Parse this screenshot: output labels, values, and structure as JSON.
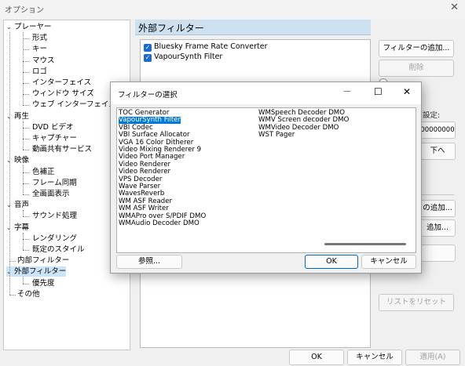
{
  "window": {
    "title": "オプション",
    "close_glyph": "✕"
  },
  "tree": [
    {
      "label": "プレーヤー",
      "level": 0,
      "expanded": true
    },
    {
      "label": "形式",
      "level": 1
    },
    {
      "label": "キー",
      "level": 1
    },
    {
      "label": "マウス",
      "level": 1
    },
    {
      "label": "ロゴ",
      "level": 1
    },
    {
      "label": "インターフェイス",
      "level": 1
    },
    {
      "label": "ウィンドウ サイズ",
      "level": 1
    },
    {
      "label": "ウェブ インターフェイス",
      "level": 1
    },
    {
      "label": "再生",
      "level": 0,
      "expanded": true
    },
    {
      "label": "DVD ビデオ",
      "level": 1
    },
    {
      "label": "キャプチャー",
      "level": 1
    },
    {
      "label": "動画共有サービス",
      "level": 1
    },
    {
      "label": "映像",
      "level": 0,
      "expanded": true
    },
    {
      "label": "色補正",
      "level": 1
    },
    {
      "label": "フレーム同期",
      "level": 1
    },
    {
      "label": "全画面表示",
      "level": 1
    },
    {
      "label": "音声",
      "level": 0,
      "expanded": true
    },
    {
      "label": "サウンド処理",
      "level": 1
    },
    {
      "label": "字幕",
      "level": 0,
      "expanded": true
    },
    {
      "label": "レンダリング",
      "level": 1
    },
    {
      "label": "既定のスタイル",
      "level": 1
    },
    {
      "label": "内部フィルター",
      "level": 0
    },
    {
      "label": "外部フィルター",
      "level": 0,
      "expanded": true,
      "selected": true
    },
    {
      "label": "優先度",
      "level": 1
    },
    {
      "label": "その他",
      "level": 0
    }
  ],
  "panel": {
    "title": "外部フィルター",
    "filters": [
      "Bluesky Frame Rate Converter",
      "VapourSynth Filter"
    ],
    "add_filter": "フィルターの追加...",
    "remove": "削除",
    "partial_setting": "設定:",
    "partial_value": "00000000",
    "partial_down": "下へ",
    "partial_add1": "の追加...",
    "partial_add2": "追加...",
    "reset_list": "リストをリセット"
  },
  "dialog": {
    "title": "フィルターの選択",
    "min_glyph": "—",
    "max_glyph": "☐",
    "close_glyph": "✕",
    "col1": [
      "TOC Generator",
      "VapourSynth Filter",
      "VBI Codec",
      "VBI Surface Allocator",
      "VGA 16 Color Ditherer",
      "Video Mixing Renderer 9",
      "Video Port Manager",
      "Video Renderer",
      "Video Renderer",
      "VPS Decoder",
      "Wave Parser",
      "WavesReverb",
      "WM ASF Reader",
      "WM ASF Writer",
      "WMAPro over S/PDIF DMO",
      "WMAudio Decoder DMO"
    ],
    "col2": [
      "WMSpeech Decoder DMO",
      "WMV Screen decoder DMO",
      "WMVideo Decoder DMO",
      "WST Pager"
    ],
    "selected": "VapourSynth Filter",
    "browse": "参照...",
    "ok": "OK",
    "cancel": "キャンセル"
  },
  "footer": {
    "ok": "OK",
    "cancel": "キャンセル",
    "apply": "適用(A)"
  }
}
